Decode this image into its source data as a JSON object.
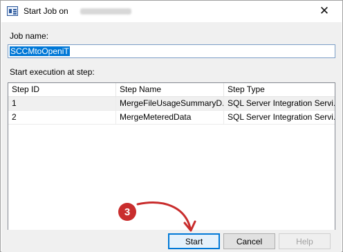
{
  "window": {
    "title": "Start Job on",
    "close_glyph": "✕"
  },
  "form": {
    "job_name_label": "Job name:",
    "job_name_value": "SCCMtoOpeniT",
    "start_step_label": "Start execution at step:"
  },
  "grid": {
    "headers": [
      "Step ID",
      "Step Name",
      "Step Type"
    ],
    "rows": [
      [
        "1",
        "MergeFileUsageSummaryD...",
        "SQL Server Integration Servi..."
      ],
      [
        "2",
        "MergeMeteredData",
        "SQL Server Integration Servi..."
      ]
    ],
    "selected_row": 0
  },
  "buttons": {
    "start": "Start",
    "cancel": "Cancel",
    "help": "Help"
  },
  "annotation": {
    "step_number": "3",
    "color": "#c92d2d"
  },
  "icons": {
    "app": "job-dialog-icon",
    "close": "close-icon"
  },
  "colors": {
    "selection": "#0078d7",
    "content_bg": "#f0f0f0"
  }
}
